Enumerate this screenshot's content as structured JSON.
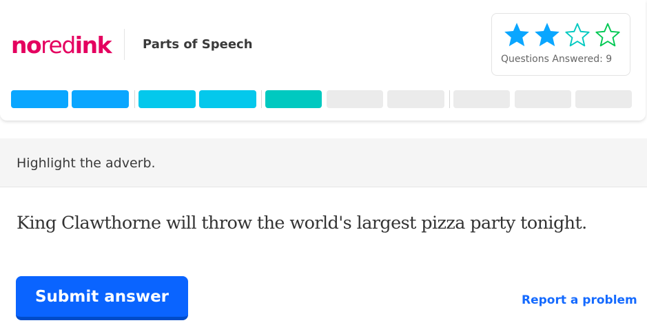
{
  "header": {
    "logo": {
      "part1": "no",
      "part2": "red",
      "part3": "ink"
    },
    "topic_title": "Parts of Speech",
    "score": {
      "stars_filled": 2,
      "stars_total": 4,
      "questions_answered_label": "Questions Answered: 9"
    }
  },
  "progress": {
    "segments": [
      {
        "status": "complete",
        "color": "#0aa6ff"
      },
      {
        "status": "complete",
        "color": "#0aa6ff"
      },
      {
        "status": "complete",
        "color": "#04c8ec"
      },
      {
        "status": "complete",
        "color": "#04c8ec"
      },
      {
        "status": "complete",
        "color": "#00c9c0"
      },
      {
        "status": "incomplete",
        "color": "#ebebeb"
      },
      {
        "status": "incomplete",
        "color": "#ebebeb"
      },
      {
        "status": "incomplete",
        "color": "#ebebeb"
      },
      {
        "status": "incomplete",
        "color": "#ebebeb"
      },
      {
        "status": "incomplete",
        "color": "#ebebeb"
      }
    ]
  },
  "exercise": {
    "prompt": "Highlight the adverb.",
    "sentence": "King Clawthorne will throw the world's largest pizza party tonight."
  },
  "actions": {
    "submit_label": "Submit answer",
    "report_label": "Report a problem"
  },
  "colors": {
    "brand": "#e4005f",
    "star_filled": "#0aa6ff",
    "star_outline_1": "#00c9c0",
    "star_outline_2": "#00c853",
    "primary_button": "#0a64ff",
    "link": "#146aff"
  },
  "icons": {
    "star_filled": "star-filled-icon",
    "star_empty": "star-outline-icon"
  }
}
